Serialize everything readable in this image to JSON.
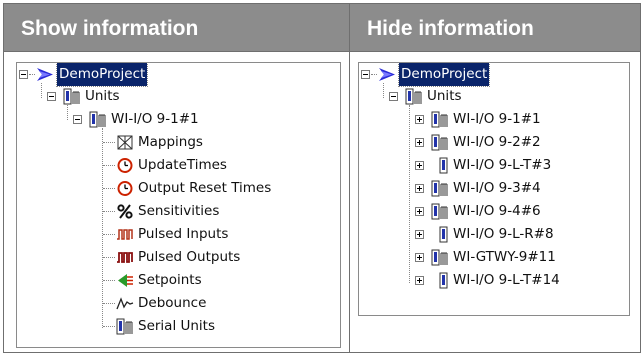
{
  "left_panel": {
    "header": "Show information",
    "project": "DemoProject",
    "units": "Units",
    "unit": "WI-I/O 9-1#1",
    "children": [
      {
        "label": "Mappings",
        "icon": "mappings-icon"
      },
      {
        "label": "UpdateTimes",
        "icon": "clock-icon"
      },
      {
        "label": "Output Reset Times",
        "icon": "clock-icon"
      },
      {
        "label": "Sensitivities",
        "icon": "percent-icon"
      },
      {
        "label": "Pulsed Inputs",
        "icon": "pulse-icon"
      },
      {
        "label": "Pulsed Outputs",
        "icon": "pulse-icon"
      },
      {
        "label": "Setpoints",
        "icon": "setpoint-icon"
      },
      {
        "label": "Debounce",
        "icon": "debounce-icon"
      },
      {
        "label": "Serial Units",
        "icon": "serial-unit-icon"
      }
    ]
  },
  "right_panel": {
    "header": "Hide information",
    "project": "DemoProject",
    "units": "Units",
    "unit_items": [
      {
        "label": "WI-I/O 9-1#1",
        "icon": "unit-module-icon"
      },
      {
        "label": "WI-I/O 9-2#2",
        "icon": "unit-module-icon"
      },
      {
        "label": "WI-I/O 9-L-T#3",
        "icon": "unit-small-icon"
      },
      {
        "label": "WI-I/O 9-3#4",
        "icon": "unit-module-icon"
      },
      {
        "label": "WI-I/O 9-4#6",
        "icon": "unit-module-icon"
      },
      {
        "label": "WI-I/O 9-L-R#8",
        "icon": "unit-small-icon"
      },
      {
        "label": "WI-GTWY-9#11",
        "icon": "unit-module-icon"
      },
      {
        "label": "WI-I/O 9-L-T#14",
        "icon": "unit-small-icon"
      }
    ]
  },
  "colors": {
    "header_bg": "#8c8c8c",
    "selection": "#0a246a",
    "arrow": "#2b2bd8",
    "clock": "#cc2200"
  }
}
